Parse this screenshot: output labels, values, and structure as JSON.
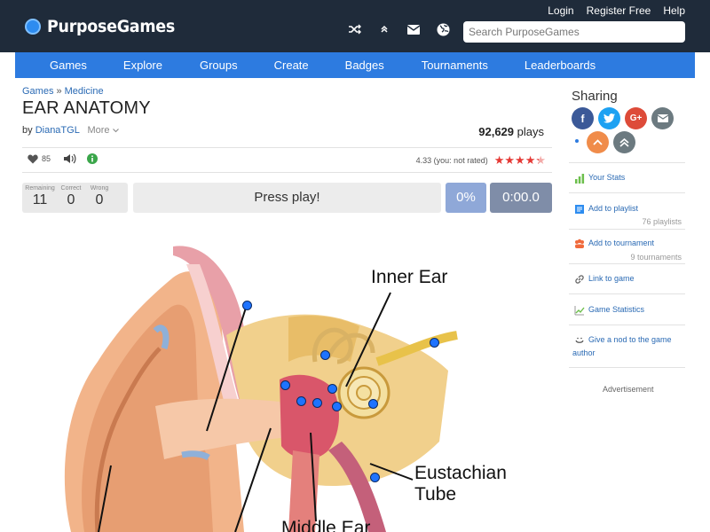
{
  "header": {
    "brand": "PurposeGames",
    "links": [
      "Login",
      "Register Free",
      "Help"
    ],
    "icons": [
      "shuffle-icon",
      "chevron-up-icon",
      "mail-icon",
      "globe-icon"
    ],
    "search_placeholder": "Search PurposeGames"
  },
  "nav": {
    "items": [
      "Games",
      "Explore",
      "Groups",
      "Create",
      "Badges",
      "Tournaments",
      "Leaderboards"
    ]
  },
  "breadcrumb": {
    "root": "Games",
    "separator": "»",
    "category": "Medicine"
  },
  "game": {
    "title": "EAR ANATOMY",
    "by_prefix": "by",
    "author": "DianaTGL",
    "more_label": "More",
    "plays_count": "92,629",
    "plays_label": "plays",
    "likes": "85",
    "rating_text": "4.33 (you: not rated)",
    "rating_value": 4.33,
    "rating_max": 5
  },
  "stats": {
    "remaining_label": "Remaining",
    "remaining": "11",
    "correct_label": "Correct",
    "correct": "0",
    "wrong_label": "Wrong",
    "wrong": "0",
    "press_play": "Press play!",
    "percent": "0%",
    "timer": "0:00.0"
  },
  "image_labels": {
    "inner_ear": "Inner Ear",
    "eustachian_1": "Eustachian",
    "eustachian_2": "Tube",
    "middle_ear": "Middle Ear"
  },
  "sidebar": {
    "sharing_title": "Sharing",
    "share_icons": [
      "facebook-icon",
      "twitter-icon",
      "google-plus-icon",
      "email-icon",
      "upvote-icon",
      "double-up-icon"
    ],
    "your_stats": "Your Stats",
    "add_playlist": "Add to playlist",
    "playlists_count": "76 playlists",
    "add_tournament": "Add to tournament",
    "tournaments_count": "9 tournaments",
    "link_to_game": "Link to game",
    "game_statistics": "Game Statistics",
    "nod_line1": "Give a nod to the game",
    "nod_line2": "author",
    "advertisement": "Advertisement"
  },
  "colors": {
    "topbar": "#1f2b3a",
    "nav": "#2d7be0",
    "link": "#2a6ab4",
    "star": "#e53935",
    "percent_box": "#8fa8d8",
    "timer_box": "#7f8da8",
    "dot": "#1e73ff"
  }
}
